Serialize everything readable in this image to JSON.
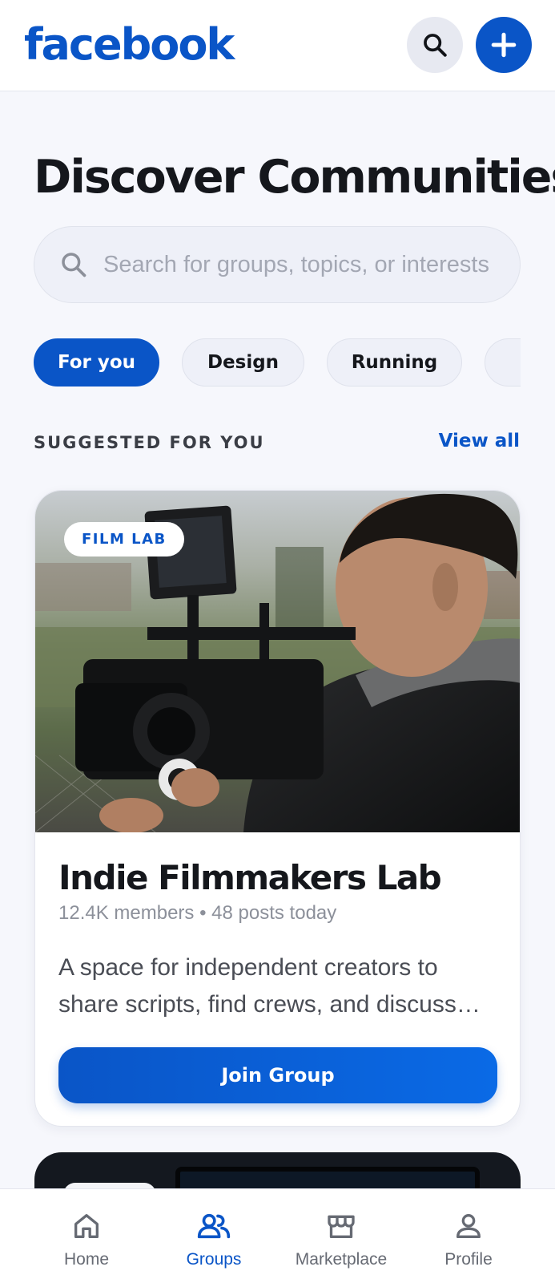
{
  "header": {
    "logo": "facebook",
    "search_icon": "search-icon",
    "add_icon": "plus-icon"
  },
  "page_title": "Discover Communities",
  "search": {
    "placeholder": "Search for groups, topics, or interests",
    "value": ""
  },
  "chips": [
    {
      "label": "For you",
      "active": true
    },
    {
      "label": "Design",
      "active": false
    },
    {
      "label": "Running",
      "active": false
    },
    {
      "label": "",
      "active": false
    }
  ],
  "suggested": {
    "label": "SUGGESTED FOR YOU",
    "view_all": "View all"
  },
  "card": {
    "badge": "FILM LAB",
    "name": "Indie Filmmakers Lab",
    "members": "12.4K members",
    "separator": "•",
    "posts": "48 posts today",
    "description": "A space for independent creators to share scripts, find crews, and discuss their latest projects.",
    "join_label": "Join Group"
  },
  "bottom_nav": [
    {
      "label": "Home",
      "icon": "home-icon",
      "active": false
    },
    {
      "label": "Groups",
      "icon": "groups-icon",
      "active": true
    },
    {
      "label": "Marketplace",
      "icon": "store-icon",
      "active": false
    },
    {
      "label": "Profile",
      "icon": "person-icon",
      "active": false
    }
  ],
  "colors": {
    "brand": "#0a55c7",
    "background": "#f6f7fc",
    "chip_inactive": "#eef0f8"
  }
}
